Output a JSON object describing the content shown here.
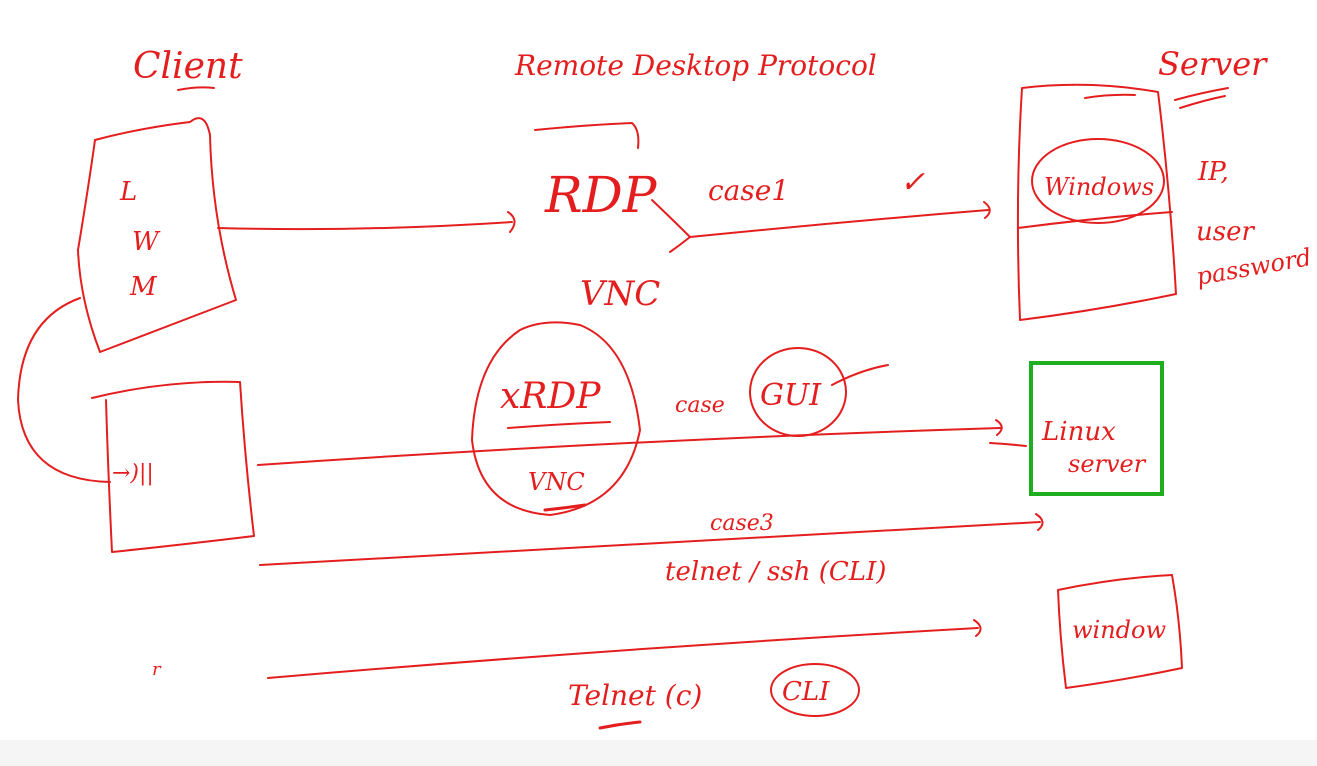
{
  "colors": {
    "ink": "#e41e1e",
    "highlight": "#1fae1f",
    "background": "#ffffff"
  },
  "labels": {
    "client": "Client",
    "protocol_title": "Remote Desktop Protocol",
    "server": "Server",
    "client_box_lines": [
      "L",
      "W",
      "M"
    ],
    "rdp": "RDP",
    "case1": "case1",
    "checkmark": "✓",
    "windows_server": "Windows",
    "credentials": [
      "IP,",
      "user",
      "password"
    ],
    "vnc_top": "VNC",
    "xrdp": "xRDP",
    "vnc_circle": "VNC",
    "case2": "case",
    "gui": "GUI",
    "client2_mark": "→)||",
    "linux_server": [
      "Linux",
      "server"
    ],
    "case3": "case3",
    "telnet_ssh": "telnet / ssh (CLI)",
    "windows_box": "window",
    "telnet_cli_label": "Telnet (c)",
    "cli": "CLI",
    "stray_mark": "r"
  }
}
